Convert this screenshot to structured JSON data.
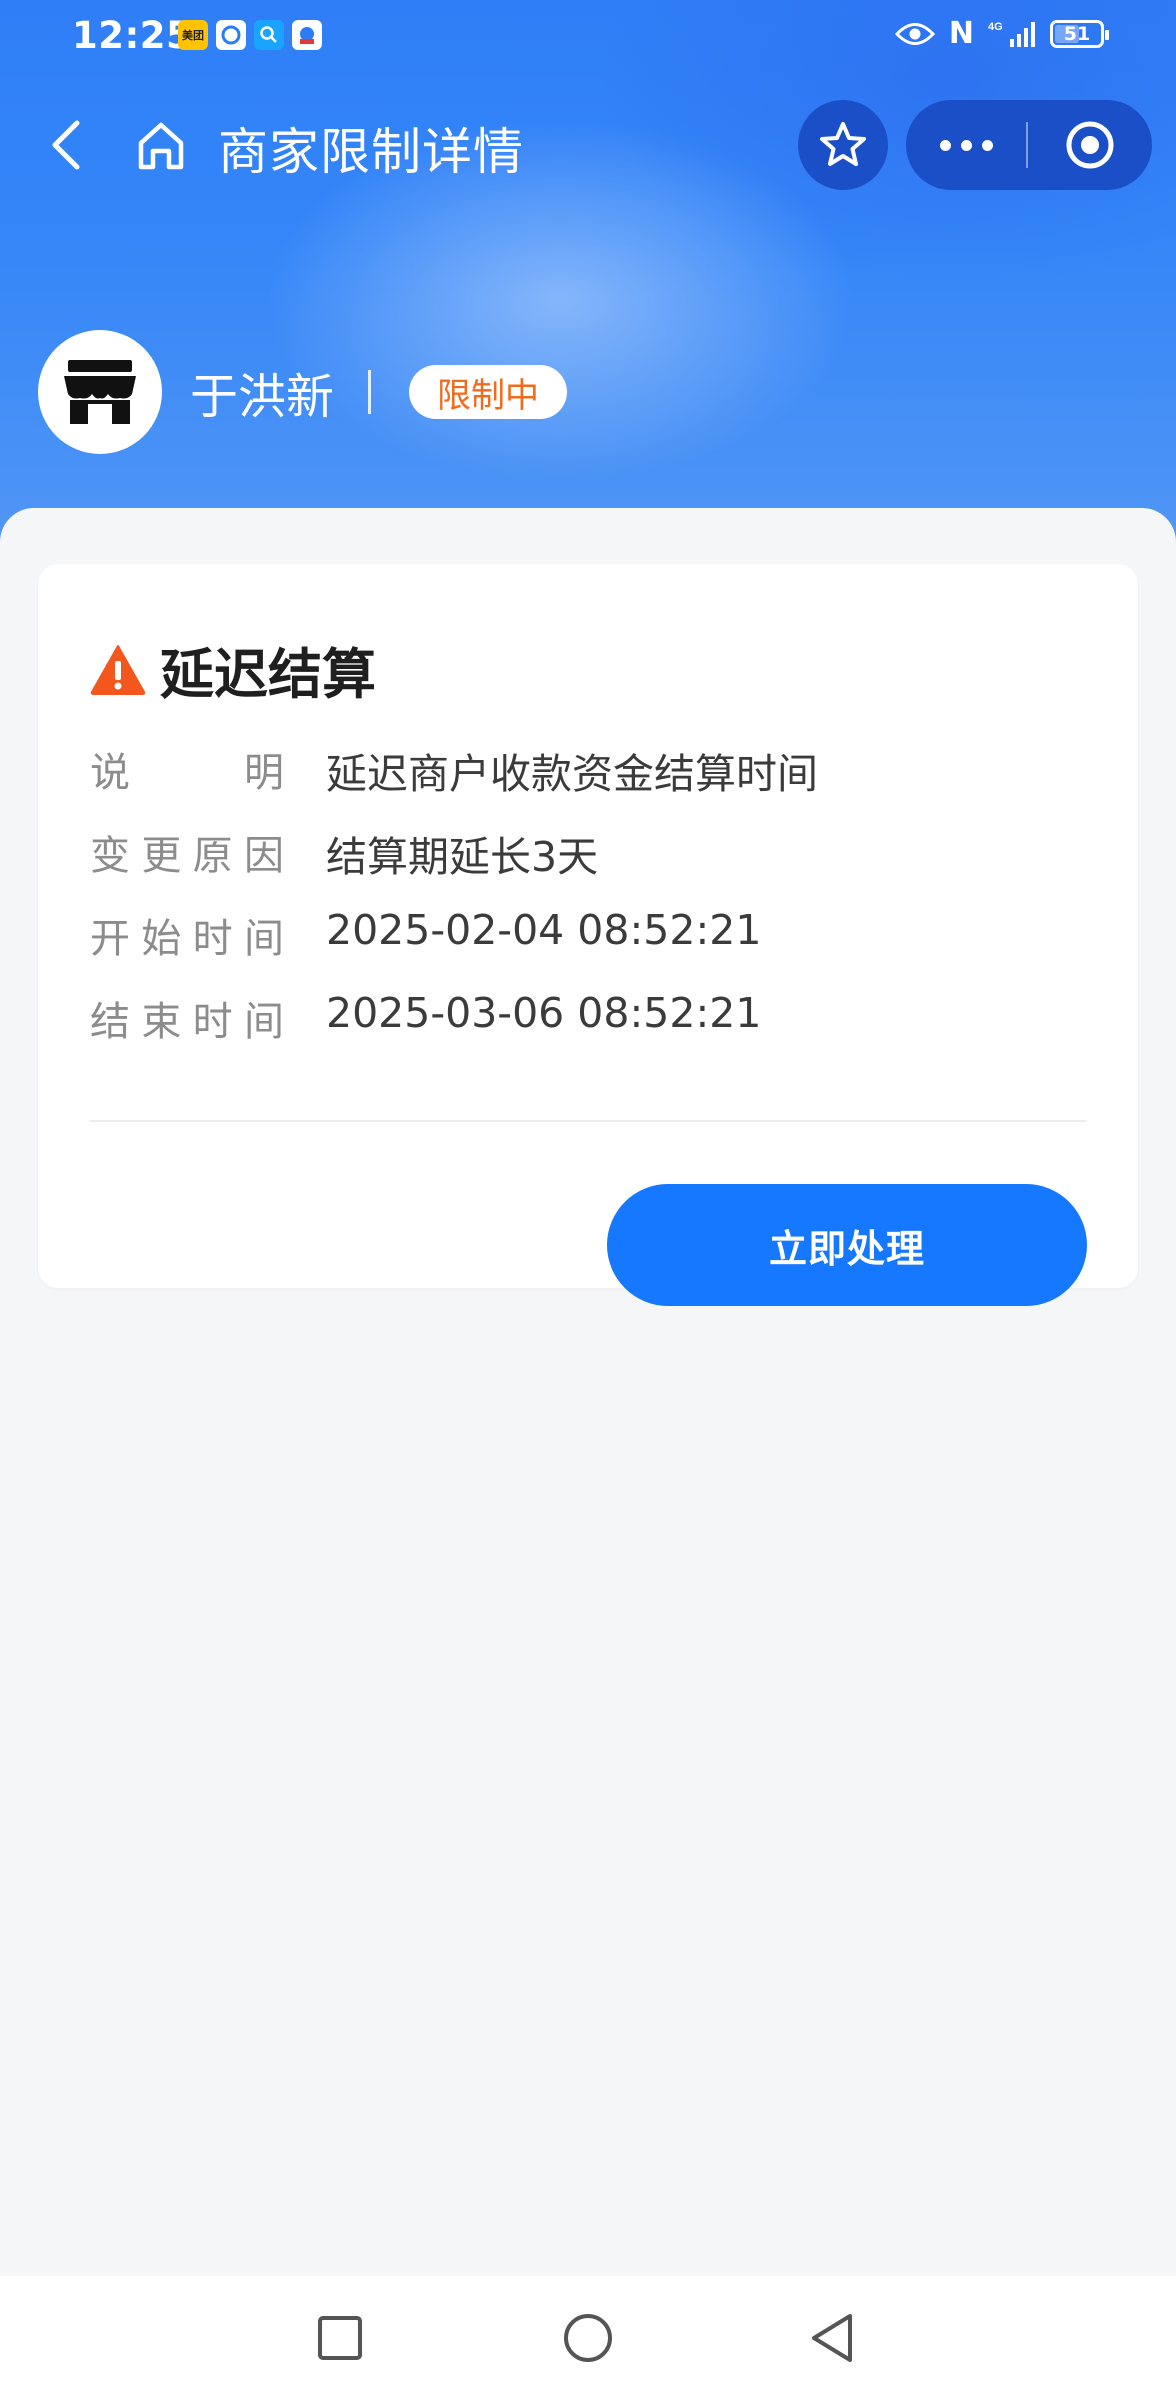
{
  "status_bar": {
    "time": "12:25",
    "notifications": [
      {
        "icon": "meituan-app-icon",
        "text": "美团"
      },
      {
        "icon": "browser-app-icon",
        "text": ""
      },
      {
        "icon": "search-app-icon",
        "text": ""
      },
      {
        "icon": "game-app-icon",
        "text": ""
      }
    ],
    "network": "4G",
    "battery": "51"
  },
  "nav": {
    "title": "商家限制详情",
    "icons": [
      "back-icon",
      "home-icon",
      "star-icon",
      "more-icon",
      "close-target-icon"
    ]
  },
  "merchant": {
    "name": "于洪新",
    "status": "限制中",
    "avatar_icon": "store-icon"
  },
  "card": {
    "title": "延迟结算",
    "rows": [
      {
        "label": [
          "说",
          "明"
        ],
        "value": "延迟商户收款资金结算时间"
      },
      {
        "label": [
          "变",
          "更",
          "原",
          "因"
        ],
        "value": "结算期延长3天"
      },
      {
        "label": [
          "开",
          "始",
          "时",
          "间"
        ],
        "value": "2025-02-04 08:52:21"
      },
      {
        "label": [
          "结",
          "束",
          "时",
          "间"
        ],
        "value": "2025-03-06 08:52:21"
      }
    ],
    "action_label": "立即处理"
  },
  "colors": {
    "primary": "#1677ff",
    "header": "#2f7ef7",
    "badge_text": "#f26b1d",
    "warning": "#f2581e"
  }
}
